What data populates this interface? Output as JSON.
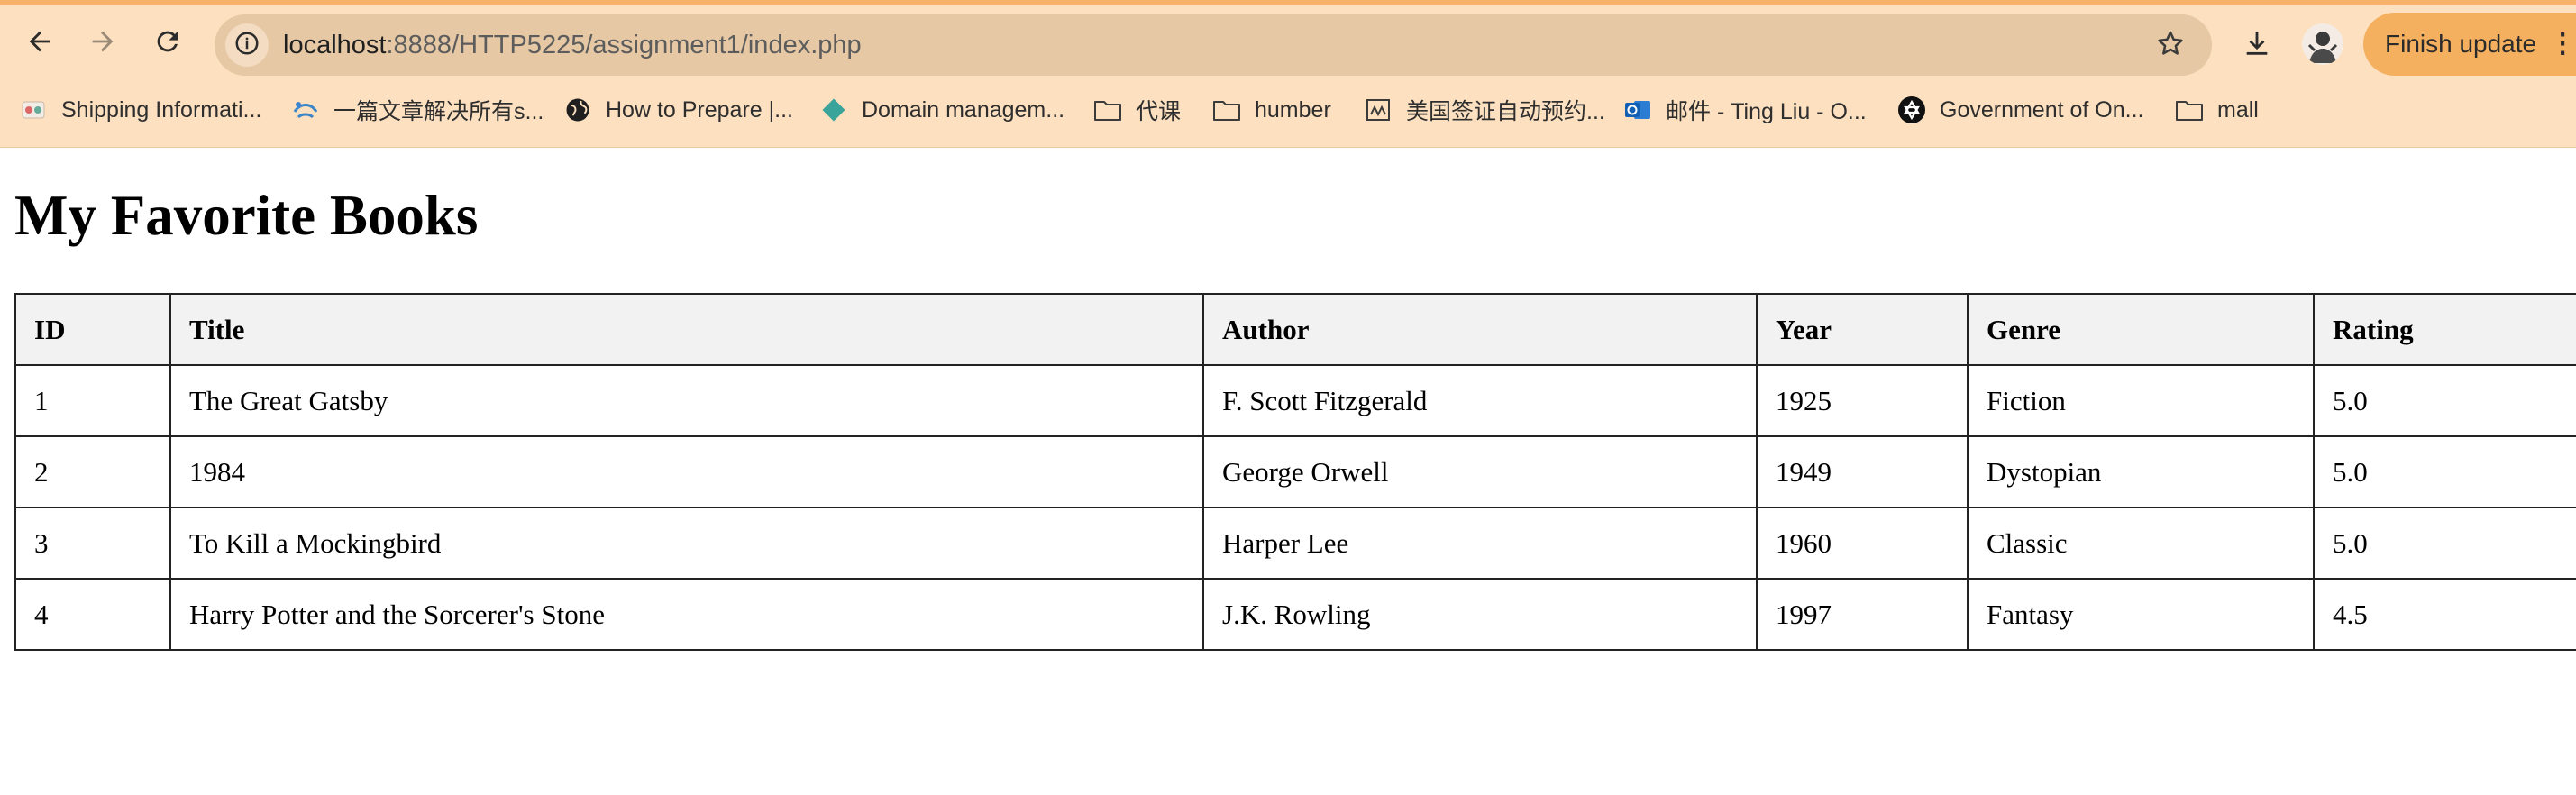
{
  "browser": {
    "url_host": "localhost",
    "url_rest": ":8888/HTTP5225/assignment1/index.php",
    "finish_update_label": "Finish update",
    "bookmarks": [
      {
        "label": "Shipping Informati...",
        "icon": "shipping-favicon"
      },
      {
        "label": "一篇文章解决所有s...",
        "icon": "article-favicon"
      },
      {
        "label": "How to Prepare |...",
        "icon": "globe-icon"
      },
      {
        "label": "Domain managem...",
        "icon": "diamond-favicon"
      },
      {
        "label": "代课",
        "icon": "folder-icon"
      },
      {
        "label": "humber",
        "icon": "folder-icon"
      },
      {
        "label": "美国签证自动预约...",
        "icon": "visa-favicon"
      },
      {
        "label": "邮件 - Ting Liu - O...",
        "icon": "outlook-icon"
      },
      {
        "label": "Government of On...",
        "icon": "ontario-icon"
      },
      {
        "label": "mall",
        "icon": "folder-icon"
      }
    ]
  },
  "page": {
    "title": "My Favorite Books",
    "table": {
      "headers": [
        "ID",
        "Title",
        "Author",
        "Year",
        "Genre",
        "Rating"
      ],
      "rows": [
        [
          "1",
          "The Great Gatsby",
          "F. Scott Fitzgerald",
          "1925",
          "Fiction",
          "5.0"
        ],
        [
          "2",
          "1984",
          "George Orwell",
          "1949",
          "Dystopian",
          "5.0"
        ],
        [
          "3",
          "To Kill a Mockingbird",
          "Harper Lee",
          "1960",
          "Classic",
          "5.0"
        ],
        [
          "4",
          "Harry Potter and the Sorcerer's Stone",
          "J.K. Rowling",
          "1997",
          "Fantasy",
          "4.5"
        ]
      ]
    }
  }
}
